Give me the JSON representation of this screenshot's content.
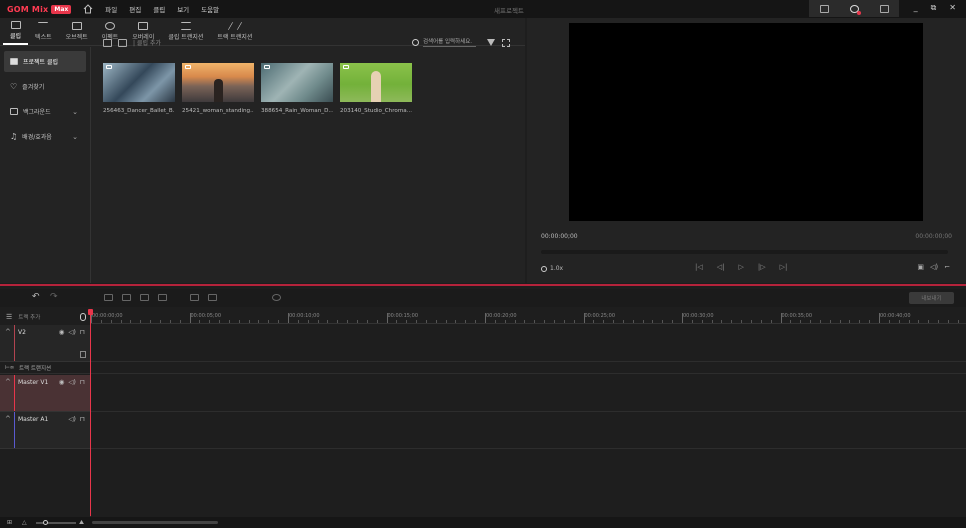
{
  "app": {
    "logo_text": "GOM Mix",
    "logo_badge": "Max",
    "project_title": "새프로젝트",
    "menu": [
      "파일",
      "편집",
      "클립",
      "보기",
      "도움말"
    ]
  },
  "tabs": [
    {
      "label": "클립",
      "icon": "clip-icon",
      "active": true
    },
    {
      "label": "텍스트",
      "icon": "text-icon"
    },
    {
      "label": "오브젝트",
      "icon": "object-icon"
    },
    {
      "label": "이펙트",
      "icon": "effect-icon"
    },
    {
      "label": "오버레이",
      "icon": "overlay-icon"
    },
    {
      "label": "클립 트랜지션",
      "icon": "clip-transition-icon"
    },
    {
      "label": "트랙 트랜지션",
      "icon": "track-transition-icon"
    }
  ],
  "sidebar": [
    {
      "label": "프로젝트 클립",
      "active": true
    },
    {
      "label": "즐겨찾기"
    },
    {
      "label": "백그라운드"
    },
    {
      "label": "배경/효과음"
    }
  ],
  "clips_toolbar": {
    "add_label": "| 클립 추가"
  },
  "search": {
    "placeholder": "검색어를 입력하세요."
  },
  "clips": [
    {
      "name": "256463_Dancer_Ballet_B..."
    },
    {
      "name": "25421_woman_standing..."
    },
    {
      "name": "388654_Rain_Woman_D..."
    },
    {
      "name": "203140_Studio_Chroma..."
    }
  ],
  "preview": {
    "current_time": "00:00:00;00",
    "total_time": "00:00:00;00",
    "zoom": "1.0x"
  },
  "timeline": {
    "export_label": "내보내기",
    "add_track_label": "트랙 추가",
    "ticks": [
      "00:00:00;00",
      "00:00:05;00",
      "00:00:10;00",
      "00:00:15;00",
      "00:00:20;00",
      "00:00:25;00",
      "00:00:30;00",
      "00:00:35;00",
      "00:00:40;00"
    ],
    "transition_row_label": "트랙 트랜지션",
    "tracks": [
      {
        "name": "V2",
        "color": "#c8505a"
      },
      {
        "name": "Master V1",
        "color": "#e8364b"
      },
      {
        "name": "Master A1",
        "color": "#6a6ae0"
      }
    ]
  }
}
